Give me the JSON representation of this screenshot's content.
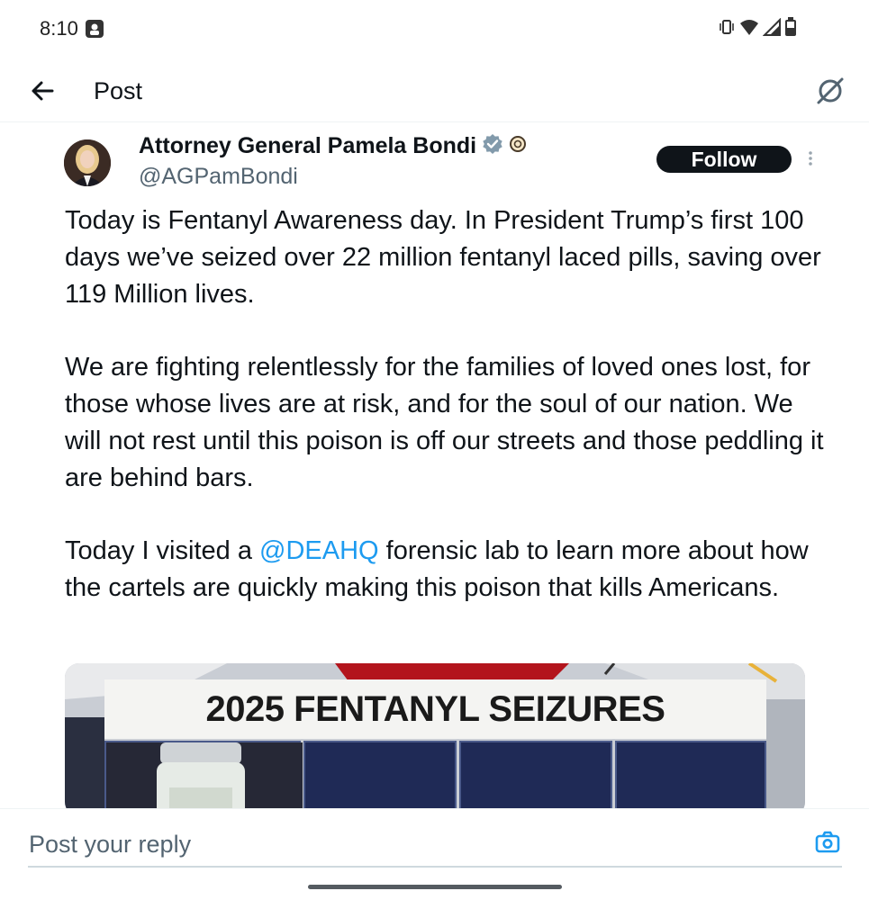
{
  "status_bar": {
    "time": "8:10",
    "icons": [
      "vibrate-icon",
      "wifi-icon",
      "signal-icon",
      "battery-icon"
    ]
  },
  "nav": {
    "title": "Post",
    "icons": [
      "back-arrow-icon",
      "grok-icon"
    ]
  },
  "post": {
    "author": {
      "display_name": "Attorney General Pamela Bondi",
      "handle": "@AGPamBondi",
      "verified_color": "#829aab",
      "follow_label": "Follow"
    },
    "text": {
      "p1": "Today is Fentanyl Awareness day. In President Trump’s first 100 days we’ve seized over 22 million fentanyl laced pills, saving over 119 Million lives.",
      "p2": "We are fighting relentlessly for the families of loved ones lost, for those whose lives are at risk, and for the soul of our nation. We will not rest until this poison is off our streets and those peddling it are behind bars.",
      "p3_before": "Today I visited a ",
      "p3_mention": "@DEAHQ",
      "p3_after": " forensic lab to learn more about how the cartels are quickly making this poison that kills Americans."
    },
    "media": {
      "title": "2025 FENTANYL SEIZURES"
    }
  },
  "reply": {
    "placeholder": "Post your reply"
  },
  "colors": {
    "text": "#0f1419",
    "secondary": "#536471",
    "link": "#1d9bf0",
    "follow_bg": "#0f1419"
  }
}
